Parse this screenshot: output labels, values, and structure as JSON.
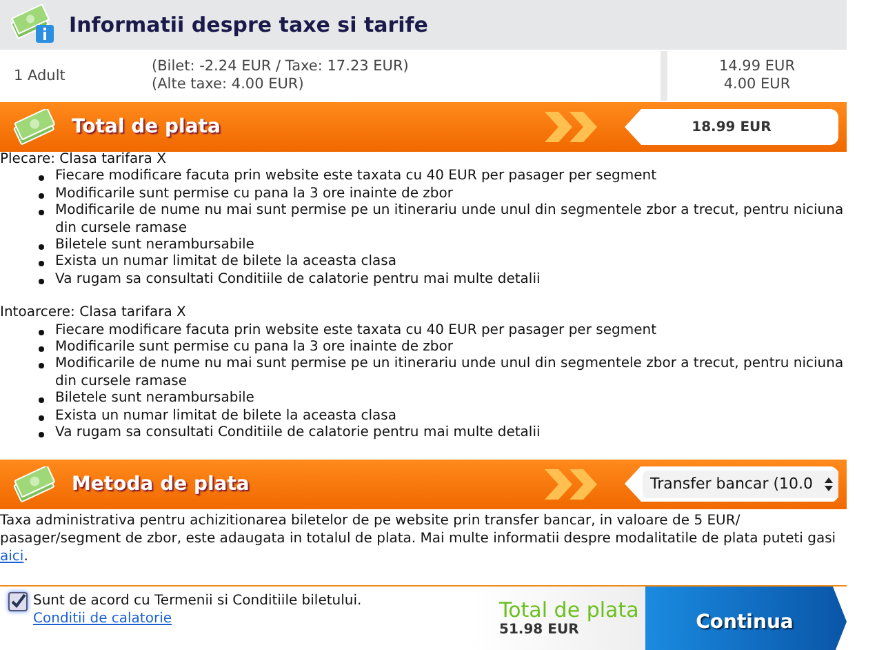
{
  "fees": {
    "title": "Informatii despre taxe si tarife",
    "passenger": "1 Adult",
    "details": [
      "(Bilet: -2.24 EUR / Taxe: 17.23 EUR)",
      "(Alte taxe: 4.00 EUR)"
    ],
    "amounts": [
      "14.99 EUR",
      "4.00 EUR"
    ]
  },
  "total_bar": {
    "title": "Total de plata",
    "amount": "18.99 EUR"
  },
  "policies": [
    {
      "heading": "Plecare: Clasa tarifara X",
      "items": [
        "Fiecare modificare facuta prin website este taxata cu 40 EUR per pasager per segment",
        "Modificarile sunt permise cu pana la 3 ore inainte de zbor",
        "Modificarile de nume nu mai sunt permise pe un itinerariu unde unul din segmentele zbor a trecut, pentru niciuna din cursele ramase",
        "Biletele sunt nerambursabile",
        "Exista un numar limitat de bilete la aceasta clasa",
        "Va rugam sa consultati Conditiile de calatorie pentru mai multe detalii"
      ]
    },
    {
      "heading": "Intoarcere: Clasa tarifara X",
      "items": [
        "Fiecare modificare facuta prin website este taxata cu 40 EUR per pasager per segment",
        "Modificarile sunt permise cu pana la 3 ore inainte de zbor",
        "Modificarile de nume nu mai sunt permise pe un itinerariu unde unul din segmentele zbor a trecut, pentru niciuna din cursele ramase",
        "Biletele sunt nerambursabile",
        "Exista un numar limitat de bilete la aceasta clasa",
        "Va rugam sa consultati Conditiile de calatorie pentru mai multe detalii"
      ]
    }
  ],
  "payment": {
    "title": "Metoda de plata",
    "method": "Transfer bancar (10.0",
    "note": "Taxa administrativa pentru achizitionarea biletelor de pe website prin transfer bancar, in valoare de 5 EUR/ pasager/segment de zbor, este adaugata in totalul de plata. Mai multe informatii despre modalitatile de plata puteti gasi ",
    "note_link": "aici",
    "note_end": "."
  },
  "footer": {
    "agree_checked": true,
    "agree": "Sunt de acord cu Termenii si Conditiile biletului. ",
    "agree_link": "Conditii de calatorie",
    "total_label": "Total de plata",
    "total": "51.98 EUR",
    "button": "Continua"
  }
}
